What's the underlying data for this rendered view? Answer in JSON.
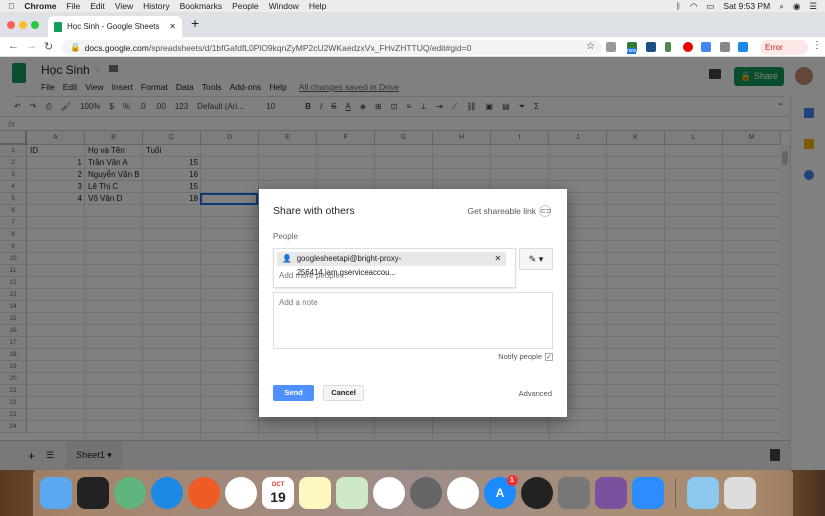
{
  "macos": {
    "apple": "",
    "app": "Chrome",
    "menus": [
      "File",
      "Edit",
      "View",
      "History",
      "Bookmarks",
      "People",
      "Window",
      "Help"
    ],
    "clock": "Sat 9:53 PM"
  },
  "browser": {
    "tab_title": "Học Sinh - Google Sheets",
    "url_host": "docs.google.com",
    "url_path": "/spreadsheets/d/1bfGafdfL0PlO9kqnZyMP2cU2WKaedzxVx_FHvZHTTUQ/edit#gid=0",
    "error_label": "Error",
    "new_badge": "new"
  },
  "sheets": {
    "title": "Học Sinh",
    "menus": [
      "File",
      "Edit",
      "View",
      "Insert",
      "Format",
      "Data",
      "Tools",
      "Add-ons",
      "Help"
    ],
    "save_status": "All changes saved in Drive",
    "share_label": "Share",
    "toolbar": {
      "zoom": "100%",
      "currency": "$",
      "percent": "%",
      "dec_less": ".0",
      "dec_more": ".00",
      "format": "123",
      "font": "Default (Ari...",
      "size": "10",
      "bold": "B",
      "italic": "I",
      "strike": "S",
      "color": "A",
      "sigma": "Σ"
    },
    "fx": "fx",
    "columns": [
      "A",
      "B",
      "C",
      "D",
      "E",
      "F",
      "G",
      "H",
      "I",
      "J",
      "K",
      "L",
      "M"
    ],
    "rows": [
      [
        "ID",
        "Họ và Tên",
        "Tuổi"
      ],
      [
        "1",
        "Trần Văn A",
        "15"
      ],
      [
        "2",
        "Nguyễn Văn B",
        "16"
      ],
      [
        "3",
        "Lê Thị C",
        "15"
      ],
      [
        "4",
        "Võ Văn D",
        "18"
      ]
    ],
    "row_count": 24,
    "sheet_tab": "Sheet1",
    "add_sheet": "+"
  },
  "dialog": {
    "title": "Share with others",
    "get_link": "Get shareable link",
    "people_label": "People",
    "chip": "googlesheetapi@bright-proxy-256414.iam.gserviceaccou...",
    "add_people_placeholder": "Add more people...",
    "note_placeholder": "Add a note",
    "notify": "Notify people",
    "notify_checked": true,
    "send": "Send",
    "cancel": "Cancel",
    "advanced": "Advanced"
  },
  "dock": {
    "calendar_month": "OCT",
    "calendar_day": "19",
    "appstore_badge": "1",
    "apps": [
      "finder",
      "terminal",
      "atom",
      "safari",
      "postman",
      "chrome",
      "calendar",
      "notes",
      "maps",
      "photos",
      "launchpad",
      "itunes",
      "app-store",
      "siri",
      "system-preferences",
      "viber",
      "zoom",
      "downloads",
      "trash"
    ]
  }
}
